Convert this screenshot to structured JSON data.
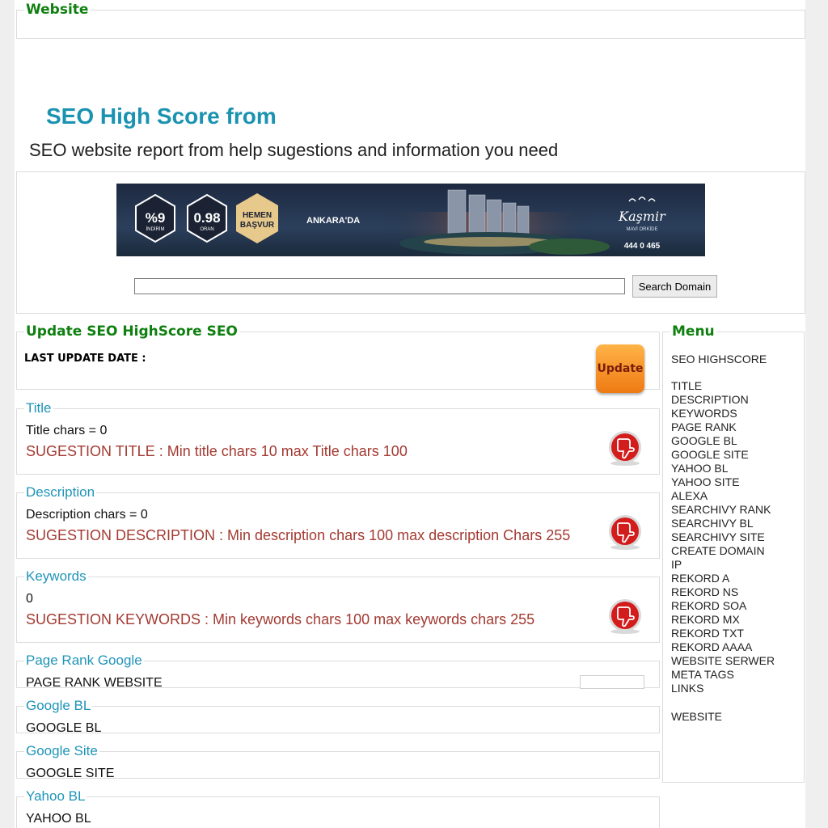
{
  "website_box": {
    "legend": "Website"
  },
  "header": {
    "title": "SEO High Score from",
    "subtitle": "SEO website report from help sugestions and information you need"
  },
  "banner": {
    "badge1_value": "%9",
    "badge1_label": "İNDİRİM",
    "badge2_value": "0.98",
    "badge2_label": "ORAN",
    "badge3_line1": "HEMEN",
    "badge3_line2": "BAŞVUR",
    "city": "ANKARA'DA",
    "brand": "Kaşmir",
    "brand_sub": "MAVİ ORKİDE",
    "phone": "444 0 465"
  },
  "search": {
    "value": "",
    "button_label": "Search Domain"
  },
  "update_box": {
    "legend": "Update SEO HighScore SEO",
    "last_update_label": "LAST UPDATE DATE :",
    "button_label": "Update"
  },
  "title_box": {
    "legend": "Title",
    "info": "Title chars = 0",
    "suggestion": "SUGESTION TITLE : Min title chars 10 max Title chars 100"
  },
  "description_box": {
    "legend": "Description",
    "info": "Description chars = 0",
    "suggestion": "SUGESTION DESCRIPTION : Min description chars 100 max description Chars 255"
  },
  "keywords_box": {
    "legend": "Keywords",
    "info": "0",
    "suggestion": "SUGESTION KEYWORDS : Min keywords chars 100 max keywords chars 255"
  },
  "pagerank_box": {
    "legend": "Page Rank Google",
    "label": "PAGE RANK WEBSITE"
  },
  "googlebl_box": {
    "legend": "Google BL",
    "label": "GOOGLE BL"
  },
  "googlesite_box": {
    "legend": "Google Site",
    "label": "GOOGLE SITE"
  },
  "yahoobl_box": {
    "legend": "Yahoo BL",
    "label": "YAHOO BL"
  },
  "menu": {
    "legend": "Menu",
    "top_item": "SEO HIGHSCORE",
    "items": [
      "TITLE",
      "DESCRIPTION",
      "KEYWORDS",
      "PAGE RANK",
      "GOOGLE BL",
      "GOOGLE SITE",
      "YAHOO BL",
      "YAHOO SITE",
      "ALEXA",
      "SEARCHIVY RANK",
      "SEARCHIVY BL",
      "SEARCHIVY SITE",
      "CREATE DOMAIN",
      "IP",
      "REKORD A",
      "REKORD NS",
      "REKORD SOA",
      "REKORD MX",
      "REKORD TXT",
      "REKORD AAAA",
      "WEBSITE SERWER",
      "META TAGS",
      "LINKS"
    ],
    "bottom_item": "WEBSITE"
  },
  "icons": {
    "thumbs_down": "thumbs-down-icon",
    "update": "update-icon"
  },
  "colors": {
    "legend_green": "#0f8010",
    "legend_teal": "#1f94b8",
    "suggestion_red": "#a33a32",
    "title_teal": "#1a93b0"
  }
}
